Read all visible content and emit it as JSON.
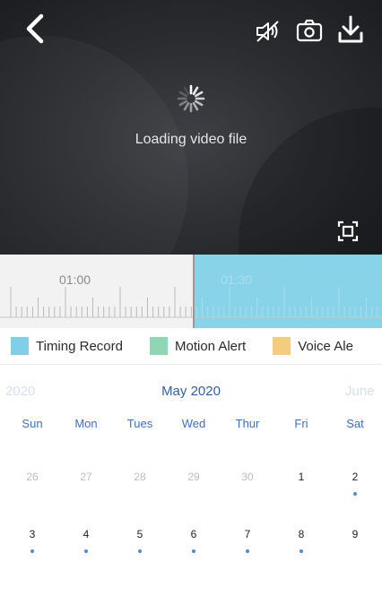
{
  "player": {
    "loading_text": "Loading video file",
    "icons": [
      "back-chevron-icon",
      "mute-icon",
      "camera-icon",
      "download-icon",
      "fullscreen-icon",
      "spinner-icon"
    ]
  },
  "timeline": {
    "labels": [
      "01:00",
      "01:30"
    ]
  },
  "legend": [
    {
      "label": "Timing Record",
      "color": "#7fcfe8"
    },
    {
      "label": "Motion Alert",
      "color": "#8fd6b4"
    },
    {
      "label": "Voice Ale",
      "color": "#f3cc7d"
    }
  ],
  "calendar": {
    "prev_month": "2020",
    "current_month": "May 2020",
    "next_month": "June",
    "weekdays": [
      "Sun",
      "Mon",
      "Tues",
      "Wed",
      "Thur",
      "Fri",
      "Sat"
    ],
    "weeks": [
      [
        {
          "day": "26",
          "in_month": false,
          "has_record": false
        },
        {
          "day": "27",
          "in_month": false,
          "has_record": false
        },
        {
          "day": "28",
          "in_month": false,
          "has_record": false
        },
        {
          "day": "29",
          "in_month": false,
          "has_record": false
        },
        {
          "day": "30",
          "in_month": false,
          "has_record": false
        },
        {
          "day": "1",
          "in_month": true,
          "has_record": false
        },
        {
          "day": "2",
          "in_month": true,
          "has_record": true
        }
      ],
      [
        {
          "day": "3",
          "in_month": true,
          "has_record": true
        },
        {
          "day": "4",
          "in_month": true,
          "has_record": true
        },
        {
          "day": "5",
          "in_month": true,
          "has_record": true
        },
        {
          "day": "6",
          "in_month": true,
          "has_record": true
        },
        {
          "day": "7",
          "in_month": true,
          "has_record": true
        },
        {
          "day": "8",
          "in_month": true,
          "has_record": true
        },
        {
          "day": "9",
          "in_month": true,
          "has_record": false
        }
      ]
    ],
    "accent_color": "#3f6fbf",
    "record_dot_color": "#4a8ed8"
  }
}
